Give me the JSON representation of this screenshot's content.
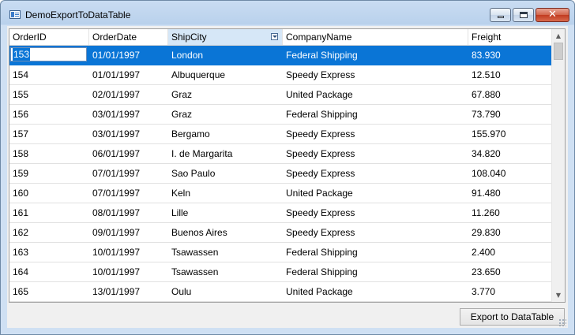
{
  "window": {
    "title": "DemoExportToDataTable"
  },
  "grid": {
    "columns": [
      "OrderID",
      "OrderDate",
      "ShipCity",
      "CompanyName",
      "Freight"
    ],
    "sorted_column": "ShipCity",
    "editing_value": "153",
    "rows": [
      [
        "153",
        "01/01/1997",
        "London",
        "Federal Shipping",
        "83.930"
      ],
      [
        "154",
        "01/01/1997",
        "Albuquerque",
        "Speedy Express",
        "12.510"
      ],
      [
        "155",
        "02/01/1997",
        "Graz",
        "United Package",
        "67.880"
      ],
      [
        "156",
        "03/01/1997",
        "Graz",
        "Federal Shipping",
        "73.790"
      ],
      [
        "157",
        "03/01/1997",
        "Bergamo",
        "Speedy Express",
        "155.970"
      ],
      [
        "158",
        "06/01/1997",
        "I. de Margarita",
        "Speedy Express",
        "34.820"
      ],
      [
        "159",
        "07/01/1997",
        "Sao Paulo",
        "Speedy Express",
        "108.040"
      ],
      [
        "160",
        "07/01/1997",
        "Keln",
        "United Package",
        "91.480"
      ],
      [
        "161",
        "08/01/1997",
        "Lille",
        "Speedy Express",
        "11.260"
      ],
      [
        "162",
        "09/01/1997",
        "Buenos Aires",
        "Speedy Express",
        "29.830"
      ],
      [
        "163",
        "10/01/1997",
        "Tsawassen",
        "Federal Shipping",
        "2.400"
      ],
      [
        "164",
        "10/01/1997",
        "Tsawassen",
        "Federal Shipping",
        "23.650"
      ],
      [
        "165",
        "13/01/1997",
        "Oulu",
        "United Package",
        "3.770"
      ]
    ]
  },
  "buttons": {
    "export": "Export to DataTable"
  },
  "colors": {
    "selection": "#0a75d6",
    "sorted_header": "#d6e7f7"
  },
  "icons": {
    "window": "app-window-icon",
    "filter": "filter-dropdown-icon"
  }
}
